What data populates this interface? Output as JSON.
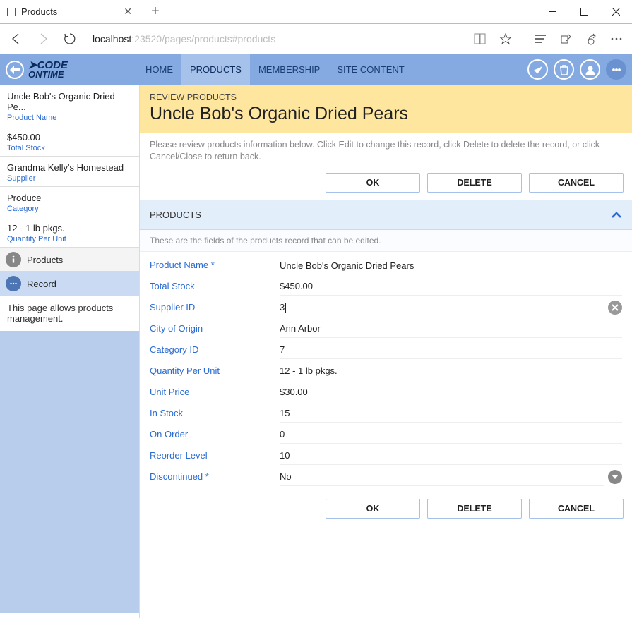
{
  "browser": {
    "tab_title": "Products",
    "url_host": "localhost",
    "url_path": ":23520/pages/products#products"
  },
  "nav": {
    "items": [
      "HOME",
      "PRODUCTS",
      "MEMBERSHIP",
      "SITE CONTENT"
    ],
    "active_index": 1
  },
  "sidebar": {
    "cards": [
      {
        "value": "Uncle Bob's Organic Dried Pe...",
        "label": "Product Name"
      },
      {
        "value": "$450.00",
        "label": "Total Stock"
      },
      {
        "value": "Grandma Kelly's Homestead",
        "label": "Supplier"
      },
      {
        "value": "Produce",
        "label": "Category"
      },
      {
        "value": "12 - 1 lb pkgs.",
        "label": "Quantity Per Unit"
      }
    ],
    "pill_products": "Products",
    "pill_record": "Record",
    "description": "This page allows products management."
  },
  "header": {
    "breadcrumb": "REVIEW PRODUCTS",
    "title": "Uncle Bob's Organic Dried Pears",
    "help": "Please review products information below. Click Edit to change this record, click Delete to delete the record, or click Cancel/Close to return back."
  },
  "buttons": {
    "ok": "OK",
    "delete": "DELETE",
    "cancel": "CANCEL"
  },
  "panel": {
    "title": "PRODUCTS",
    "help": "These are the fields of the products record that can be edited."
  },
  "fields": [
    {
      "label": "Product Name *",
      "value": "Uncle Bob's Organic Dried Pears"
    },
    {
      "label": "Total Stock",
      "value": "$450.00"
    },
    {
      "label": "Supplier ID",
      "value": "3",
      "editing": true,
      "clear": true
    },
    {
      "label": "City of Origin",
      "value": "Ann Arbor"
    },
    {
      "label": "Category ID",
      "value": "7"
    },
    {
      "label": "Quantity Per Unit",
      "value": "12 - 1 lb pkgs."
    },
    {
      "label": "Unit Price",
      "value": "$30.00"
    },
    {
      "label": "In Stock",
      "value": "15"
    },
    {
      "label": "On Order",
      "value": "0"
    },
    {
      "label": "Reorder Level",
      "value": "10"
    },
    {
      "label": "Discontinued *",
      "value": "No",
      "dropdown": true
    }
  ]
}
